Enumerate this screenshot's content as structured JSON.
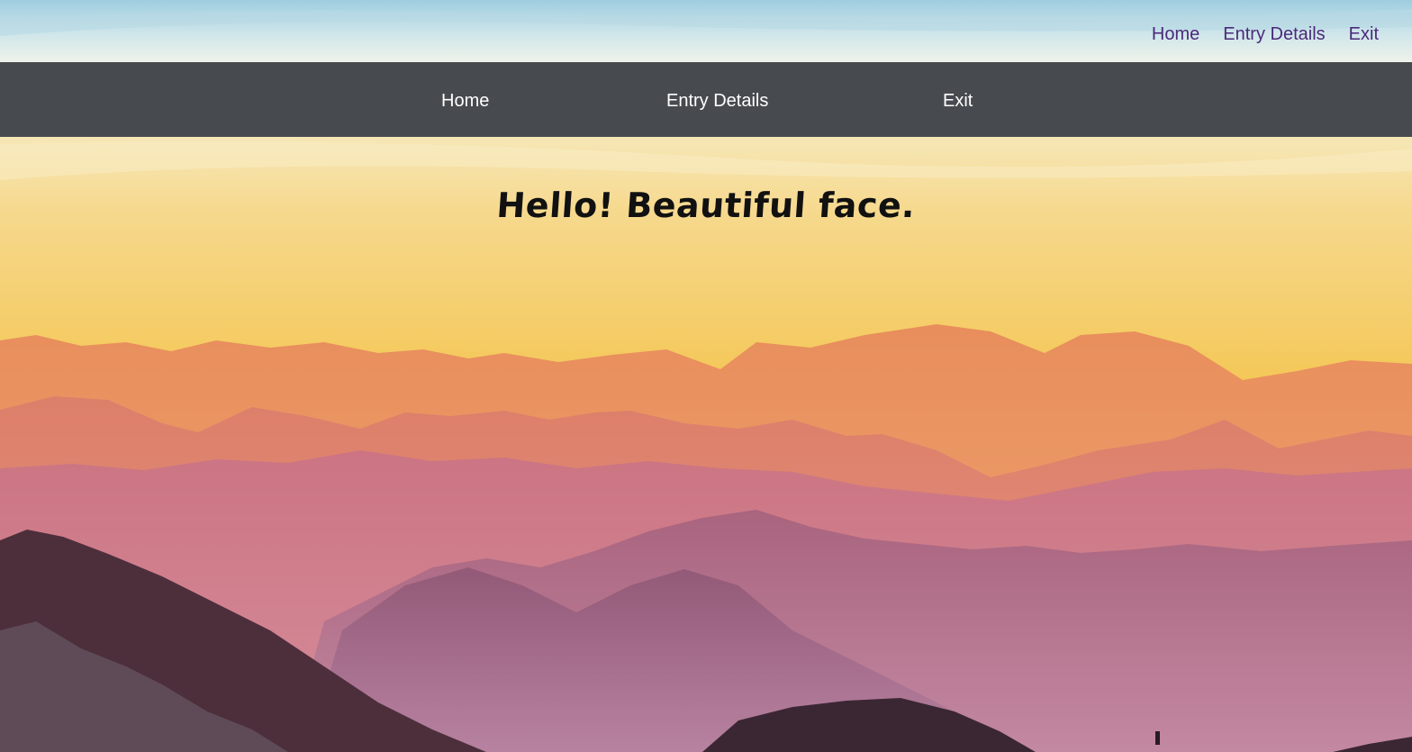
{
  "top_nav": {
    "items": [
      {
        "label": "Home"
      },
      {
        "label": "Entry Details"
      },
      {
        "label": "Exit"
      }
    ]
  },
  "main_nav": {
    "items": [
      {
        "label": "Home"
      },
      {
        "label": "Entry Details"
      },
      {
        "label": "Exit"
      }
    ]
  },
  "hero": {
    "heading": "Hello! Beautiful face."
  },
  "colors": {
    "top_link": "#4b2a7a",
    "navbar_bg": "#474b4f",
    "navbar_text": "#ffffff",
    "heading_text": "#111111"
  }
}
